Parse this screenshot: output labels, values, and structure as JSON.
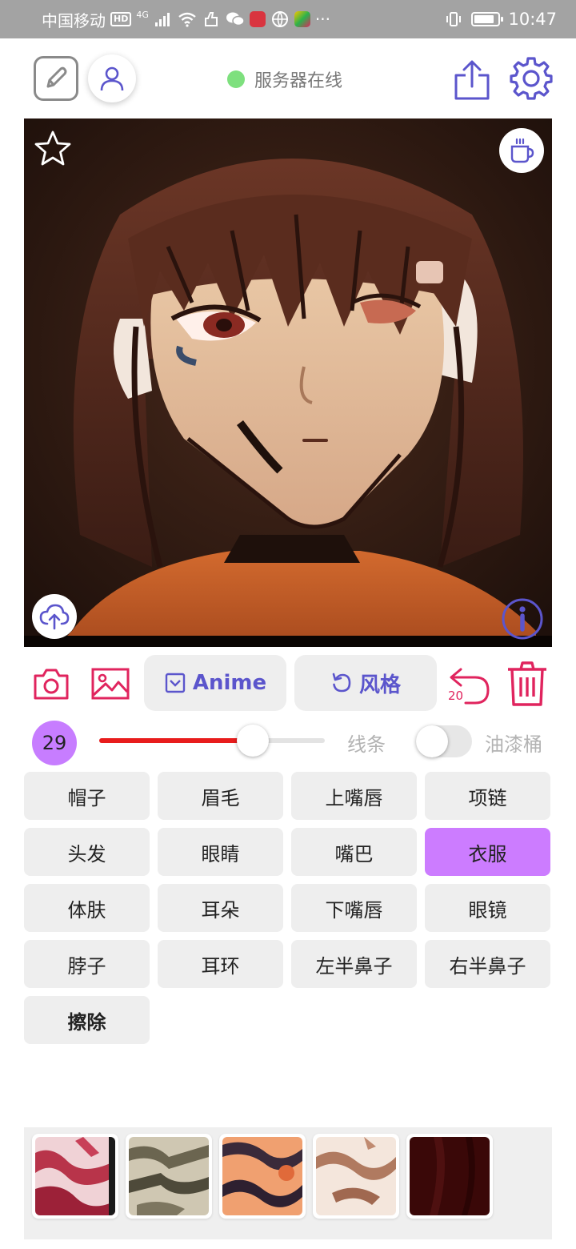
{
  "status_bar": {
    "carrier": "中国移动",
    "hd_badge": "HD",
    "network": "4G",
    "time": "10:47",
    "more": "···",
    "battery_level": 0.85
  },
  "header": {
    "server_status_text": "服务器在线",
    "server_status_color": "#7ee07e"
  },
  "toolbar": {
    "anime_label": "Anime",
    "style_label": "风格",
    "undo_count": "20"
  },
  "brush": {
    "size": "29",
    "slider_value": 0.68,
    "line_label": "线条",
    "bucket_label": "油漆桶",
    "bucket_enabled": false
  },
  "labels": [
    {
      "text": "帽子",
      "selected": false
    },
    {
      "text": "眉毛",
      "selected": false
    },
    {
      "text": "上嘴唇",
      "selected": false
    },
    {
      "text": "项链",
      "selected": false
    },
    {
      "text": "头发",
      "selected": false
    },
    {
      "text": "眼睛",
      "selected": false
    },
    {
      "text": "嘴巴",
      "selected": false
    },
    {
      "text": "衣服",
      "selected": true
    },
    {
      "text": "体肤",
      "selected": false
    },
    {
      "text": "耳朵",
      "selected": false
    },
    {
      "text": "下嘴唇",
      "selected": false
    },
    {
      "text": "眼镜",
      "selected": false
    },
    {
      "text": "脖子",
      "selected": false
    },
    {
      "text": "耳环",
      "selected": false
    },
    {
      "text": "左半鼻子",
      "selected": false
    },
    {
      "text": "右半鼻子",
      "selected": false
    },
    {
      "text": "擦除",
      "selected": false,
      "bold": true
    }
  ],
  "colors": {
    "accent_purple": "#5b55cc",
    "accent_pink": "#e0245e",
    "selected_label": "#cc7cff",
    "brush_fill": "#e81c1c"
  },
  "icons": {
    "draw": "edit-square-icon",
    "user": "user-icon",
    "share": "share-icon",
    "settings": "gear-icon",
    "star": "star-icon",
    "coffee": "coffee-icon",
    "upload": "cloud-upload-icon",
    "info": "info-icon",
    "camera": "camera-icon",
    "gallery": "image-icon",
    "undo": "undo-icon",
    "delete": "trash-icon"
  }
}
